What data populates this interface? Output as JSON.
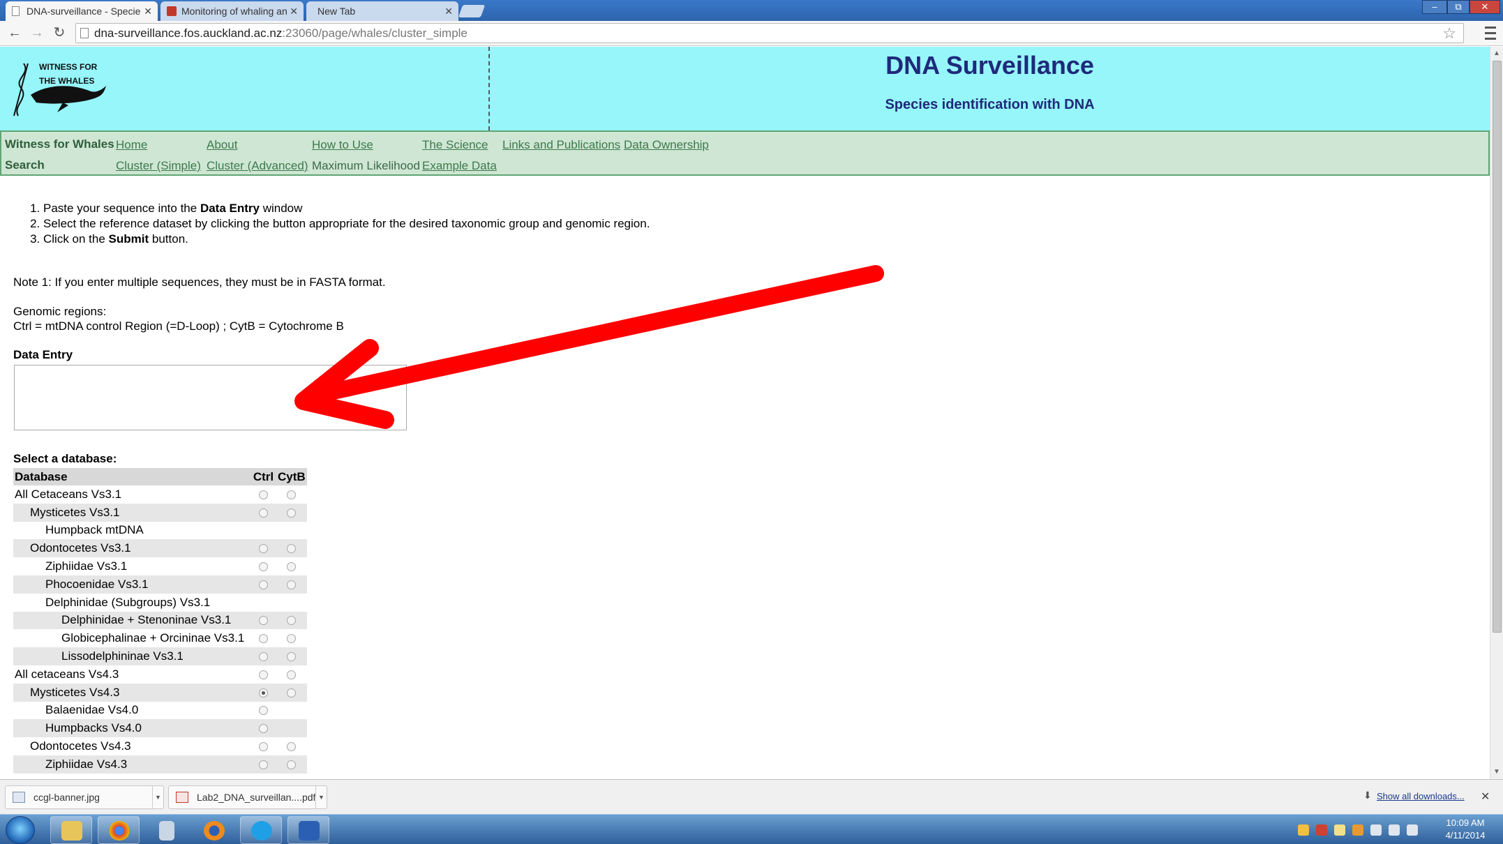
{
  "browser": {
    "tabs": [
      {
        "title": "DNA-surveillance - Specie",
        "active": true
      },
      {
        "title": "Monitoring of whaling an",
        "active": false
      },
      {
        "title": "New Tab",
        "active": false
      }
    ],
    "url_host": "dna-surveillance.fos.auckland.ac.nz",
    "url_rest": ":23060/page/whales/cluster_simple",
    "window_buttons": {
      "minimize": "–",
      "restore": "⧉",
      "close": "✕"
    }
  },
  "header": {
    "logo_line1": "WITNESS FOR",
    "logo_line2": "THE WHALES",
    "title": "DNA Surveillance",
    "subtitle": "Species identification with DNA"
  },
  "nav": {
    "row1_heading": "Witness for Whales",
    "row1_links": [
      "Home",
      "About",
      "How to Use",
      "The Science",
      "Links and Publications",
      "Data Ownership"
    ],
    "row2_heading": "Search",
    "row2_links": [
      "Cluster (Simple)",
      "Cluster (Advanced)"
    ],
    "row2_plain": "Maximum Likelihood",
    "row2_last": "Example Data"
  },
  "instructions": {
    "step1_pre": "Paste your sequence into the ",
    "step1_bold": "Data Entry",
    "step1_post": " window",
    "step2": "Select the reference dataset by clicking the button appropriate for the desired taxonomic group and genomic region.",
    "step3_pre": "Click on the ",
    "step3_bold": "Submit",
    "step3_post": " button."
  },
  "notes": {
    "note1": "Note 1: If you enter multiple sequences, they must be in FASTA format.",
    "genomic_title": "Genomic regions:",
    "genomic_def": "Ctrl = mtDNA control Region (=D-Loop) ; CytB = Cytochrome B"
  },
  "data_entry": {
    "label": "Data Entry",
    "value": ""
  },
  "database": {
    "select_label": "Select a database:",
    "col_db": "Database",
    "col_ctrl": "Ctrl",
    "col_cytb": "CytB",
    "rows": [
      {
        "name": "All Cetaceans Vs3.1",
        "level": 0,
        "ctrl": true,
        "cytb": true,
        "shade": false
      },
      {
        "name": "Mysticetes Vs3.1",
        "level": 1,
        "ctrl": true,
        "cytb": true,
        "shade": true
      },
      {
        "name": "Humpback mtDNA",
        "level": 2,
        "ctrl": false,
        "cytb": false,
        "shade": false
      },
      {
        "name": "Odontocetes Vs3.1",
        "level": 1,
        "ctrl": true,
        "cytb": true,
        "shade": true
      },
      {
        "name": "Ziphiidae Vs3.1",
        "level": 2,
        "ctrl": true,
        "cytb": true,
        "shade": false
      },
      {
        "name": "Phocoenidae Vs3.1",
        "level": 2,
        "ctrl": true,
        "cytb": true,
        "shade": true
      },
      {
        "name": "Delphinidae (Subgroups) Vs3.1",
        "level": 2,
        "ctrl": false,
        "cytb": false,
        "shade": false
      },
      {
        "name": "Delphinidae + Stenoninae Vs3.1",
        "level": 3,
        "ctrl": true,
        "cytb": true,
        "shade": true
      },
      {
        "name": "Globicephalinae + Orcininae Vs3.1",
        "level": 3,
        "ctrl": true,
        "cytb": true,
        "shade": false
      },
      {
        "name": "Lissodelphininae Vs3.1",
        "level": 3,
        "ctrl": true,
        "cytb": true,
        "shade": true
      },
      {
        "name": "All cetaceans Vs4.3",
        "level": 0,
        "ctrl": true,
        "cytb": true,
        "shade": false
      },
      {
        "name": "Mysticetes Vs4.3",
        "level": 1,
        "ctrl": true,
        "cytb": true,
        "shade": true,
        "checked": "ctrl"
      },
      {
        "name": "Balaenidae Vs4.0",
        "level": 2,
        "ctrl": true,
        "cytb": false,
        "shade": false
      },
      {
        "name": "Humpbacks Vs4.0",
        "level": 2,
        "ctrl": true,
        "cytb": false,
        "shade": true
      },
      {
        "name": "Odontocetes Vs4.3",
        "level": 1,
        "ctrl": true,
        "cytb": true,
        "shade": false
      },
      {
        "name": "Ziphiidae Vs4.3",
        "level": 2,
        "ctrl": true,
        "cytb": true,
        "shade": true
      }
    ]
  },
  "downloads": {
    "items": [
      "ccgl-banner.jpg",
      "Lab2_DNA_surveillan....pdf"
    ],
    "show_all": "Show all downloads...",
    "close": "✕"
  },
  "taskbar": {
    "clock_time": "10:09 AM",
    "clock_date": "4/11/2014"
  },
  "colors": {
    "banner": "#96f6fa",
    "title": "#1f2a7a",
    "nav_bg": "#cfe6d4",
    "arrow": "#ff0000"
  }
}
